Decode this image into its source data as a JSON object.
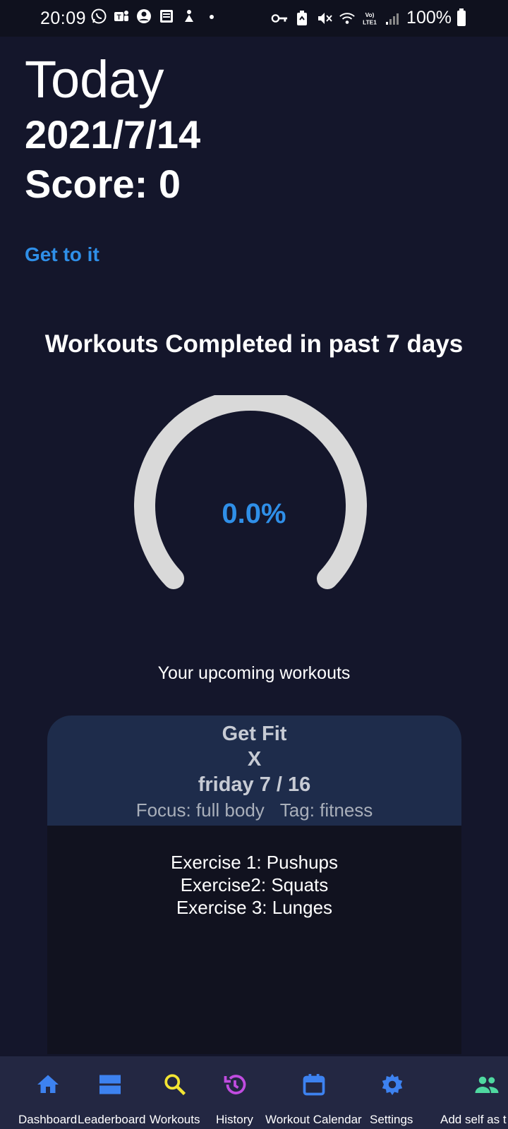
{
  "status_bar": {
    "time": "20:09",
    "battery": "100%"
  },
  "header": {
    "title": "Today",
    "date": "2021/7/14",
    "score": "Score: 0"
  },
  "cta": {
    "label": "Get to it"
  },
  "progress": {
    "title": "Workouts Completed in past 7 days",
    "value_label": "0.0%",
    "value": 0.0
  },
  "upcoming": {
    "label": "Your upcoming workouts",
    "card": {
      "title": "Get Fit",
      "close": "X",
      "date": "friday 7 / 16",
      "focus": "Focus: full body",
      "tag": "Tag: fitness",
      "exercises": [
        "Exercise 1: Pushups",
        "Exercise2: Squats",
        "Exercise 3: Lunges"
      ]
    }
  },
  "nav": {
    "items": [
      {
        "label": "Dashboard",
        "icon": "home-icon",
        "color": "#3d82f0"
      },
      {
        "label": "Leaderboard",
        "icon": "leaderboard-icon",
        "color": "#3d82f0"
      },
      {
        "label": "Workouts",
        "icon": "search-icon",
        "color": "#f3e533"
      },
      {
        "label": "History",
        "icon": "history-icon",
        "color": "#c04ce0"
      },
      {
        "label": "Workout Calendar",
        "icon": "calendar-icon",
        "color": "#3d82f0"
      },
      {
        "label": "Settings",
        "icon": "gear-icon",
        "color": "#3d82f0"
      },
      {
        "label": "Add self as t",
        "icon": "people-icon",
        "color": "#4fd8a0"
      }
    ]
  },
  "colors": {
    "background": "#14162b",
    "accent": "#2f8fe8",
    "card_header": "#1e2c4b",
    "nav_background": "#232742",
    "gauge_track": "#d9d9d9"
  }
}
